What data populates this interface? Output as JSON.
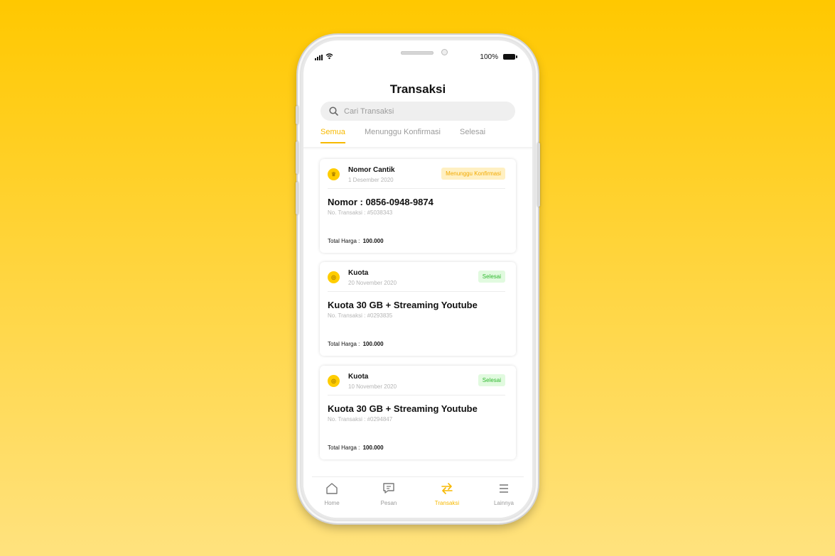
{
  "status_bar": {
    "battery": "100%"
  },
  "header": {
    "title": "Transaksi"
  },
  "search": {
    "placeholder": "Cari Transaksi"
  },
  "tabs": [
    {
      "label": "Semua",
      "active": true
    },
    {
      "label": "Menunggu Konfirmasi",
      "active": false
    },
    {
      "label": "Selesai",
      "active": false
    }
  ],
  "transactions": [
    {
      "category": "Nomor Cantik",
      "date": "1 Desember 2020",
      "status": "Menunggu Konfirmasi",
      "title": "Nomor : 0856-0948-9874",
      "trx_no": "No. Transaksi : #5038343",
      "total_label": "Total Harga :",
      "total_value": "100.000"
    },
    {
      "category": "Kuota",
      "date": "20 November 2020",
      "status": "Selesai",
      "title": "Kuota 30 GB + Streaming Youtube",
      "trx_no": "No. Transaksi : #0293835",
      "total_label": "Total Harga :",
      "total_value": "100.000"
    },
    {
      "category": "Kuota",
      "date": "10 November 2020",
      "status": "Selesai",
      "title": "Kuota 30 GB + Streaming Youtube",
      "trx_no": "No. Transaksi : #0294847",
      "total_label": "Total Harga :",
      "total_value": "100.000"
    }
  ],
  "bottom_nav": [
    {
      "label": "Home",
      "icon": "home-icon"
    },
    {
      "label": "Pesan",
      "icon": "message-icon"
    },
    {
      "label": "Transaksi",
      "icon": "transfer-icon",
      "active": true
    },
    {
      "label": "Lainnya",
      "icon": "menu-icon"
    }
  ],
  "colors": {
    "accent": "#F7B900",
    "background": "#FFC800",
    "pending_bg": "#FFF0C2",
    "done_bg": "#E1FADF",
    "done_text": "#2EB82E"
  }
}
